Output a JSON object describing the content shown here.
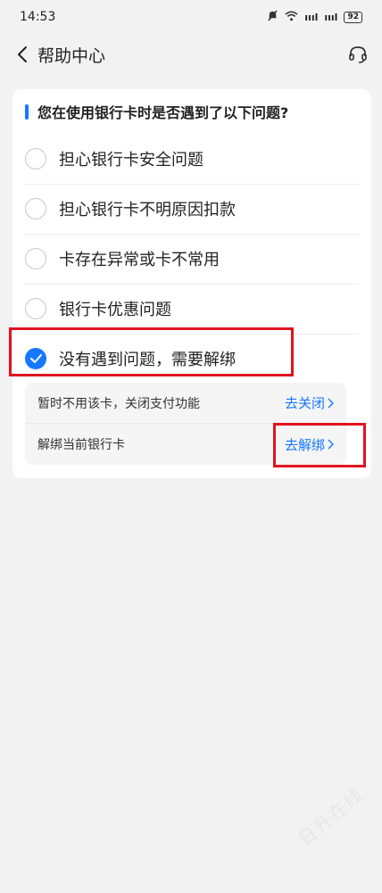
{
  "status_bar": {
    "time": "14:53",
    "signal1": "ıııl",
    "signal2": "ıııl",
    "battery": "92"
  },
  "nav": {
    "title": "帮助中心"
  },
  "question": "您在使用银行卡时是否遇到了以下问题?",
  "options": [
    {
      "label": "担心银行卡安全问题",
      "checked": false
    },
    {
      "label": "担心银行卡不明原因扣款",
      "checked": false
    },
    {
      "label": "卡存在异常或卡不常用",
      "checked": false
    },
    {
      "label": "银行卡优惠问题",
      "checked": false
    },
    {
      "label": "没有遇到问题，需要解绑",
      "checked": true
    }
  ],
  "sub_rows": [
    {
      "label": "暂时不用该卡，关闭支付功能",
      "action": "去关闭"
    },
    {
      "label": "解绑当前银行卡",
      "action": "去解绑"
    }
  ],
  "colors": {
    "accent": "#1677ff",
    "highlight": "#e0141e",
    "background": "#f2f2f2"
  },
  "watermark": "日升在线"
}
